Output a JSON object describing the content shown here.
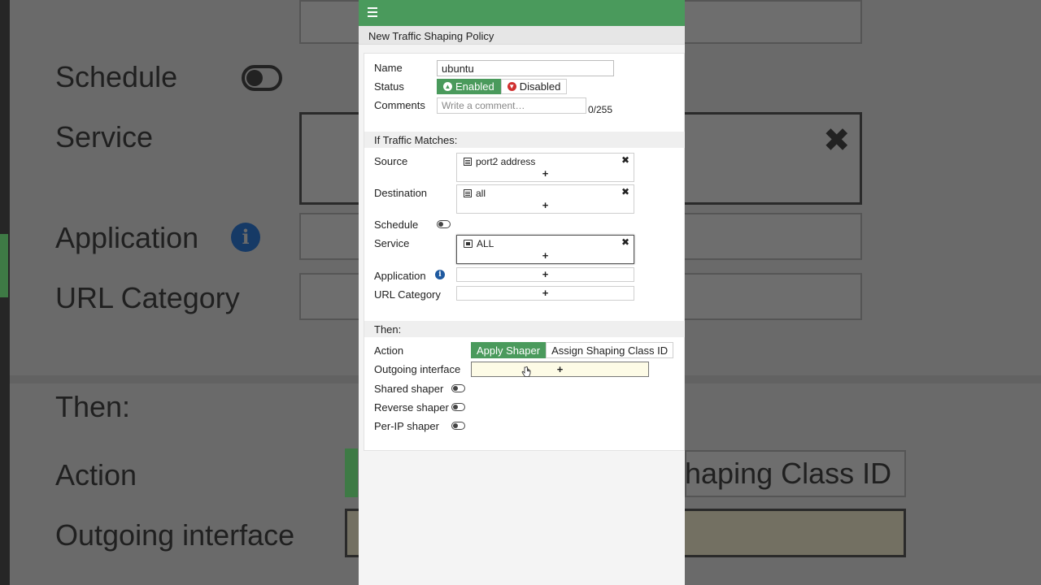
{
  "background": {
    "schedule_label": "Schedule",
    "service_label": "Service",
    "application_label": "Application",
    "url_category_label": "URL Category",
    "then_label": "Then:",
    "action_label": "Action",
    "outgoing_interface_label": "Outgoing interface",
    "shaping_class_text": "haping Class ID"
  },
  "panel": {
    "title": "New Traffic Shaping Policy",
    "name_label": "Name",
    "name_value": "ubuntu",
    "status_label": "Status",
    "status_enabled": "Enabled",
    "status_disabled": "Disabled",
    "comments_label": "Comments",
    "comments_placeholder": "Write a comment…",
    "comments_counter": "0/255",
    "if_traffic_matches": "If Traffic Matches:",
    "source_label": "Source",
    "source_value": "port2 address",
    "destination_label": "Destination",
    "destination_value": "all",
    "schedule_label": "Schedule",
    "service_label": "Service",
    "service_value": "ALL",
    "application_label": "Application",
    "url_category_label": "URL Category",
    "then_label": "Then:",
    "action_label": "Action",
    "action_apply": "Apply Shaper",
    "action_assign": "Assign Shaping Class ID",
    "outgoing_interface_label": "Outgoing interface",
    "shared_shaper_label": "Shared shaper",
    "reverse_shaper_label": "Reverse shaper",
    "per_ip_shaper_label": "Per-IP shaper",
    "add_symbol": "+",
    "remove_symbol": "✖"
  },
  "colors": {
    "accent": "#4a9a5c",
    "disabled_red": "#d03030",
    "info_blue": "#1f5aa0"
  },
  "icons": [
    "menu-icon",
    "address-icon",
    "service-icon",
    "info-icon",
    "remove-icon",
    "hand-cursor-icon"
  ]
}
